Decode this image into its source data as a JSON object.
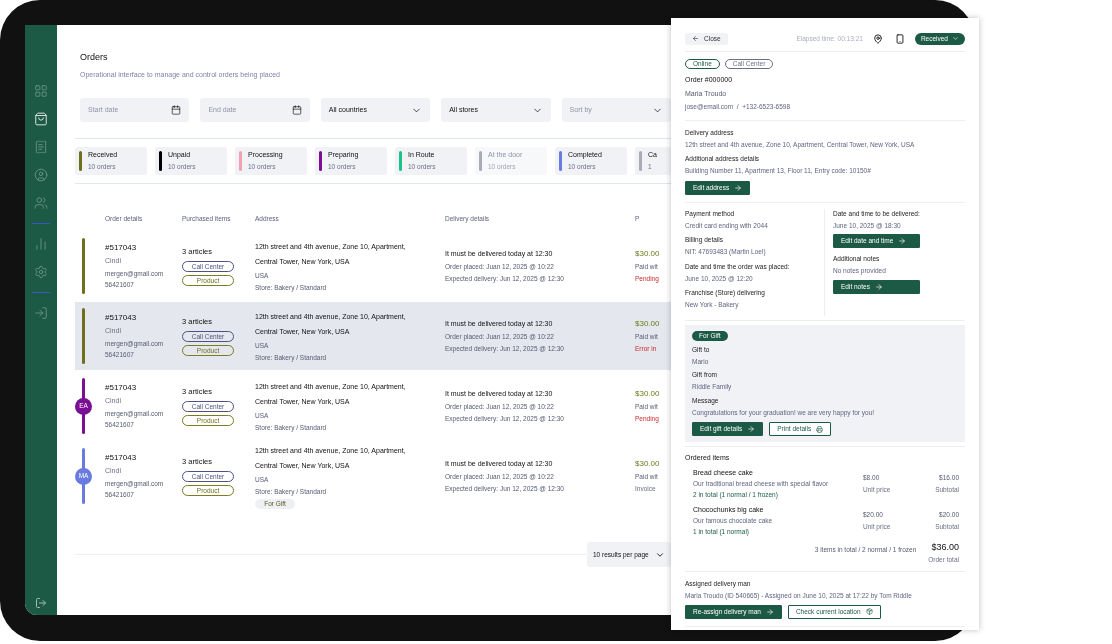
{
  "sidebar": {
    "items": [
      {
        "selected": false
      },
      {
        "selected": true
      },
      {
        "selected": false
      },
      {
        "selected": false
      },
      {
        "selected": false
      },
      {
        "selected": false
      },
      {
        "selected": false
      },
      {
        "selected": false
      }
    ]
  },
  "header": {
    "title": "Orders",
    "subtitle": "Operational interface to manage and control orders being placed"
  },
  "filters": [
    {
      "kind": "date",
      "placeholder": "Start date"
    },
    {
      "kind": "date",
      "placeholder": "End date"
    },
    {
      "kind": "select",
      "value": "All countries"
    },
    {
      "kind": "select",
      "value": "All stores"
    },
    {
      "kind": "select",
      "placeholder": "Sort by"
    }
  ],
  "statuses": [
    {
      "label": "Received",
      "count": "10 orders",
      "color": "#6f6f1c",
      "disabled": false
    },
    {
      "label": "Unpaid",
      "count": "10 orders",
      "color": "#000000",
      "disabled": false
    },
    {
      "label": "Processing",
      "count": "10 orders",
      "color": "#eea2b2",
      "disabled": false
    },
    {
      "label": "Preparing",
      "count": "10 orders",
      "color": "#7a0f96",
      "disabled": false
    },
    {
      "label": "In Route",
      "count": "10 orders",
      "color": "#19c388",
      "disabled": false
    },
    {
      "label": "At the door",
      "count": "10 orders",
      "color": "#a9abb9",
      "disabled": true
    },
    {
      "label": "Completed",
      "count": "10 orders",
      "color": "#6a7be0",
      "disabled": false
    },
    {
      "label": "Ca",
      "count": "1",
      "color": "#a9abb9",
      "disabled": false
    }
  ],
  "table": {
    "columns": [
      "Order details",
      "Purchased items",
      "Address",
      "Delivery details",
      "P"
    ],
    "rows": [
      {
        "selected": false,
        "color": "#6f6f1c",
        "order": "#517043",
        "name": "Cindi",
        "email": "mergen@gmail.com",
        "phone": "56421607",
        "articles": "3 articles",
        "tags": [
          {
            "label": "Call Center",
            "kind": "channel"
          },
          {
            "label": "Product",
            "kind": "product"
          }
        ],
        "address": "12th street and 4th avenue, Zone 10, Apartment, Central Tower, New York, USA",
        "country": "USA",
        "store": "Store: Bakery / Standard",
        "delivery": "It must be delivered today at 12:30",
        "placed": "Order placed: Juan 12, 2025 @ 10:22",
        "expected": "Expected delivery: Jun 12, 2025 @ 12:30",
        "amount": "$30.00",
        "payment": "Paid wit",
        "status": {
          "text": "Pending",
          "kind": "alert"
        }
      },
      {
        "selected": true,
        "color": "#6f6f1c",
        "order": "#517043",
        "name": "Cindi",
        "email": "mergen@gmail.com",
        "phone": "56421607",
        "articles": "3 articles",
        "tags": [
          {
            "label": "Call Center",
            "kind": "channel"
          },
          {
            "label": "Product",
            "kind": "product"
          }
        ],
        "address": "12th street and 4th avenue, Zone 10, Apartment, Central Tower, New York, USA",
        "country": "USA",
        "store": "Store: Bakery / Standard",
        "delivery": "It must be delivered today at 12:30",
        "placed": "Order placed: Juan 12, 2025 @ 10:22",
        "expected": "Expected delivery: Jun 12, 2025 @ 12:30",
        "amount": "$30.00",
        "payment": "Paid wit",
        "status": {
          "text": "Error in",
          "kind": "alert"
        }
      },
      {
        "selected": false,
        "color": "#7a0f96",
        "avatar": "EA",
        "order": "#517043",
        "name": "Cindi",
        "email": "mergen@gmail.com",
        "phone": "56421607",
        "articles": "3 articles",
        "tags": [
          {
            "label": "Call Center",
            "kind": "channel"
          },
          {
            "label": "Product",
            "kind": "product"
          }
        ],
        "address": "12th street and 4th avenue, Zone 10, Apartment, Central Tower, New York, USA",
        "country": "USA",
        "store": "Store: Bakery / Standard",
        "delivery": "It must be delivered today at 12:30",
        "placed": "Order placed: Juan 12, 2025 @ 10:22",
        "expected": "Expected delivery: Jun 12, 2025 @ 12:30",
        "amount": "$30.00",
        "payment": "Paid wit",
        "status": {
          "text": "Pending",
          "kind": "alert"
        }
      },
      {
        "selected": false,
        "color": "#6a7be0",
        "avatar": "MA",
        "order": "#517043",
        "name": "Cindi",
        "email": "mergen@gmail.com",
        "phone": "56421607",
        "articles": "3 articles",
        "tags": [
          {
            "label": "Call Center",
            "kind": "channel"
          },
          {
            "label": "Product",
            "kind": "product"
          }
        ],
        "address": "12th street and 4th avenue, Zone 10, Apartment, Central Tower, New York, USA",
        "country": "USA",
        "store": "Store: Bakery / Standard",
        "gift": "For Gift",
        "delivery": "It must be delivered today at 12:30",
        "placed": "Order placed: Juan 12, 2025 @ 10:22",
        "expected": "Expected delivery: Jun 12, 2025 @ 12:30",
        "amount": "$30.00",
        "payment": "Paid wit",
        "status": {
          "text": "Invoice",
          "kind": "info"
        }
      }
    ]
  },
  "pagination": {
    "page_size": "10 results per page"
  },
  "panel": {
    "close": "Close",
    "elapsed": "Elapsed time: 00:13:21",
    "status": "Received",
    "tags": [
      {
        "label": "Online",
        "kind": "primary"
      },
      {
        "label": "Call Center",
        "kind": "neutral"
      }
    ],
    "order": "Order #000000",
    "customer": "Maria Troudo",
    "contact": "jose@email.com  /  +132-6523-6598",
    "address_fields": [
      {
        "label": "Delivery address",
        "value": "12th street and 4th avenue, Zone 10, Apartment, Central Tower, New York, USA"
      },
      {
        "label": "Additional address details",
        "value": "Building Number 11, Apartment 13, Floor 11, Entry code: 10150#"
      }
    ],
    "edit_address": "Edit address",
    "left_fields": [
      {
        "label": "Payment method",
        "value": "Credit card ending with 2044"
      },
      {
        "label": "Billing details",
        "value": "NIT: 47693483 (Martin Loel)"
      },
      {
        "label": "Date and time the order was placed:",
        "value": "June 10, 2025 @ 12:20"
      },
      {
        "label": "Franchise (Store) delivering",
        "value": "New York - Bakery"
      }
    ],
    "right_fields": [
      {
        "label": "Date and time to be delivered:",
        "value": "June 10, 2025 @ 18:30",
        "button": "Edit date and time"
      },
      {
        "label": "Additional notes",
        "value": "No notes provided",
        "button": "Edit notes"
      }
    ],
    "gift": {
      "badge": "For Gift",
      "fields": [
        {
          "label": "Gift to",
          "value": "Mario"
        },
        {
          "label": "Gift from",
          "value": "Riddle Family"
        },
        {
          "label": "Message",
          "value": "Congratulations for your graduation! we are very happy for you!"
        }
      ],
      "buttons": [
        {
          "label": "Edit gift details",
          "kind": "primary"
        },
        {
          "label": "Print details",
          "kind": "outline"
        }
      ]
    },
    "items_title": "Ordered items",
    "items": [
      {
        "name": "Bread cheese cake",
        "description": "Our traditional bread cheese with special flavor",
        "quantity": "2 in total (1 normal / 1 frozen)",
        "unit_price": "$8.00",
        "unit_label": "Unit price",
        "subtotal": "$16.00",
        "subtotal_label": "Subtotal"
      },
      {
        "name": "Chocochunks big cake",
        "description": "Our famous chocolate cake",
        "quantity": "1 in total (1 normal)",
        "unit_price": "$20.00",
        "unit_label": "Unit price",
        "subtotal": "$20.00",
        "subtotal_label": "Subtotal"
      }
    ],
    "summary": "3 items in total / 2 normal / 1 frozen",
    "total": "$36.00",
    "total_label": "Order total",
    "delivery_label": "Assigned delivery man",
    "delivery_value": "Maria Troudo (ID 540665) - Assigned on June 10, 2025 at 17:22 by Tom Riddle",
    "delivery_buttons": [
      {
        "label": "Re-assign delivery man",
        "kind": "primary"
      },
      {
        "label": "Check current location",
        "kind": "outline"
      }
    ]
  }
}
